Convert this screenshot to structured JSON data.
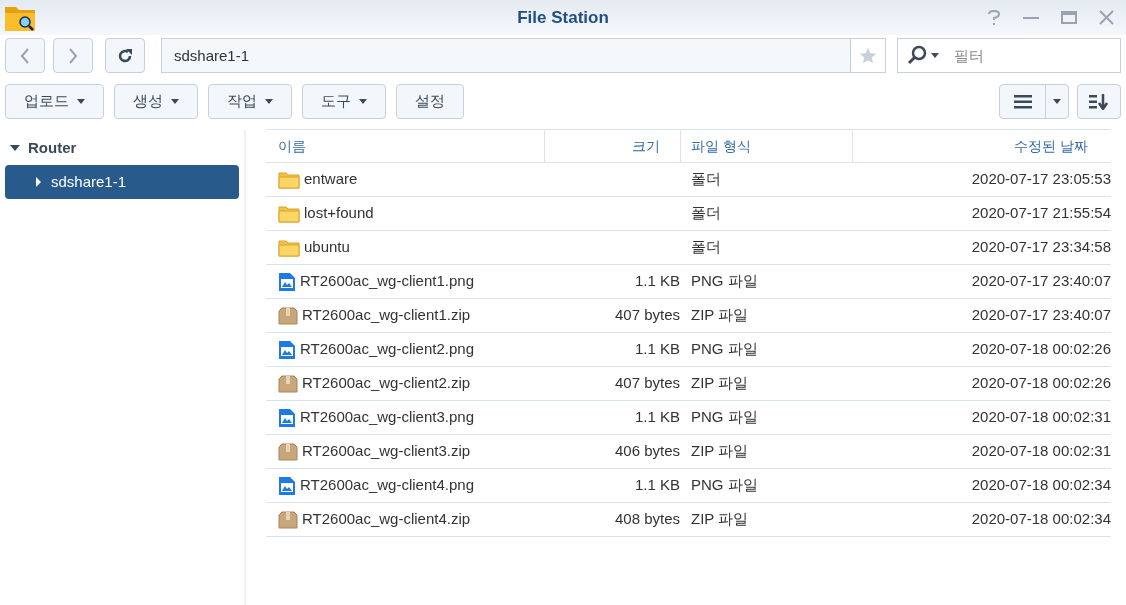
{
  "window": {
    "title": "File Station"
  },
  "path_field": {
    "value": "sdshare1-1"
  },
  "filter_field": {
    "placeholder": "필터"
  },
  "action_buttons": [
    {
      "label": "업로드",
      "dropdown": true
    },
    {
      "label": "생성",
      "dropdown": true
    },
    {
      "label": "작업",
      "dropdown": true
    },
    {
      "label": "도구",
      "dropdown": true
    },
    {
      "label": "설정",
      "dropdown": false
    }
  ],
  "sidebar": {
    "items": [
      {
        "label": "Router",
        "expanded": true,
        "selected": false,
        "children": [
          {
            "label": "sdshare1-1",
            "expanded": false,
            "selected": true
          }
        ]
      }
    ]
  },
  "table": {
    "columns": [
      "이름",
      "크기",
      "파일 형식",
      "수정된 날짜"
    ],
    "rows": [
      {
        "kind": "folder",
        "name": "entware",
        "size": "",
        "type": "폴더",
        "modified": "2020-07-17 23:05:53"
      },
      {
        "kind": "folder",
        "name": "lost+found",
        "size": "",
        "type": "폴더",
        "modified": "2020-07-17 21:55:54"
      },
      {
        "kind": "folder",
        "name": "ubuntu",
        "size": "",
        "type": "폴더",
        "modified": "2020-07-17 23:34:58"
      },
      {
        "kind": "image",
        "name": "RT2600ac_wg-client1.png",
        "size": "1.1 KB",
        "type": "PNG 파일",
        "modified": "2020-07-17 23:40:07"
      },
      {
        "kind": "archive",
        "name": "RT2600ac_wg-client1.zip",
        "size": "407 bytes",
        "type": "ZIP 파일",
        "modified": "2020-07-17 23:40:07"
      },
      {
        "kind": "image",
        "name": "RT2600ac_wg-client2.png",
        "size": "1.1 KB",
        "type": "PNG 파일",
        "modified": "2020-07-18 00:02:26"
      },
      {
        "kind": "archive",
        "name": "RT2600ac_wg-client2.zip",
        "size": "407 bytes",
        "type": "ZIP 파일",
        "modified": "2020-07-18 00:02:26"
      },
      {
        "kind": "image",
        "name": "RT2600ac_wg-client3.png",
        "size": "1.1 KB",
        "type": "PNG 파일",
        "modified": "2020-07-18 00:02:31"
      },
      {
        "kind": "archive",
        "name": "RT2600ac_wg-client3.zip",
        "size": "406 bytes",
        "type": "ZIP 파일",
        "modified": "2020-07-18 00:02:31"
      },
      {
        "kind": "image",
        "name": "RT2600ac_wg-client4.png",
        "size": "1.1 KB",
        "type": "PNG 파일",
        "modified": "2020-07-18 00:02:34"
      },
      {
        "kind": "archive",
        "name": "RT2600ac_wg-client4.zip",
        "size": "408 bytes",
        "type": "ZIP 파일",
        "modified": "2020-07-18 00:02:34"
      }
    ]
  }
}
